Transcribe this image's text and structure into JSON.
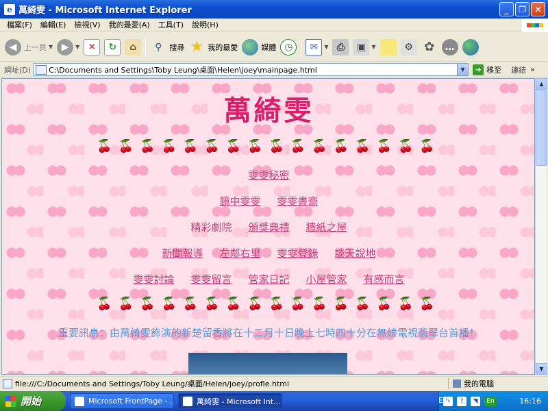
{
  "window": {
    "title": "萬綺雯 - Microsoft Internet Explorer",
    "controls": [
      "_",
      "❐",
      "✕"
    ]
  },
  "menu": [
    "檔案(F)",
    "編輯(E)",
    "檢視(V)",
    "我的最愛(A)",
    "工具(T)",
    "說明(H)"
  ],
  "toolbar": {
    "back": "上一頁",
    "search": "搜尋",
    "favorites": "我的最愛",
    "media": "媒體"
  },
  "address": {
    "label": "網址(D)",
    "url": "C:\\Documents and Settings\\Toby Leung\\桌面\\Helen\\joey\\mainpage.html",
    "go": "移至",
    "links": "連結"
  },
  "page": {
    "title": "萬綺雯",
    "cherries": "🍒🍒🍒🍒🍒🍒🍒🍒🍒🍒🍒🍒🍒🍒🍒🍒",
    "nav_rows": [
      [
        {
          "label": "雯雯秘密",
          "link": true
        }
      ],
      [
        {
          "label": "鏡中雯雯",
          "link": true
        },
        {
          "label": "雯雯書齋",
          "link": true
        }
      ],
      [
        {
          "label": "精彩劇院",
          "link": false
        },
        {
          "label": "頒獎典禮",
          "link": true
        },
        {
          "label": "牆紙之屋",
          "link": true
        }
      ],
      [
        {
          "label": "新聞報導",
          "link": true
        },
        {
          "label": "左鄰右里",
          "link": true
        },
        {
          "label": "雯雯登錄",
          "link": true
        },
        {
          "label": "談天說地",
          "link": true
        }
      ],
      [
        {
          "label": "雯雯討論",
          "link": true
        },
        {
          "label": "雯雯留言",
          "link": true
        },
        {
          "label": "管家日記",
          "link": true
        },
        {
          "label": "小屋管家",
          "link": true
        },
        {
          "label": "有感而言",
          "link": true
        }
      ]
    ],
    "notice": "重要訊息：由萬綺雯飾演的新楚留香將在十二月十日晚上七時四十分在無線電視翡翠台首播！"
  },
  "status": {
    "text": "file:///C:/Documents and Settings/Toby Leung/桌面/Helen/joey/profle.html",
    "zone": "我的電腦"
  },
  "taskbar": {
    "start": "開始",
    "tasks": [
      {
        "label": "Microsoft FrontPage - ...",
        "active": false
      },
      {
        "label": "萬綺雯 - Microsoft Int...",
        "active": true
      }
    ],
    "lang": "EN",
    "tray_badge": "En",
    "clock": "16:16"
  }
}
